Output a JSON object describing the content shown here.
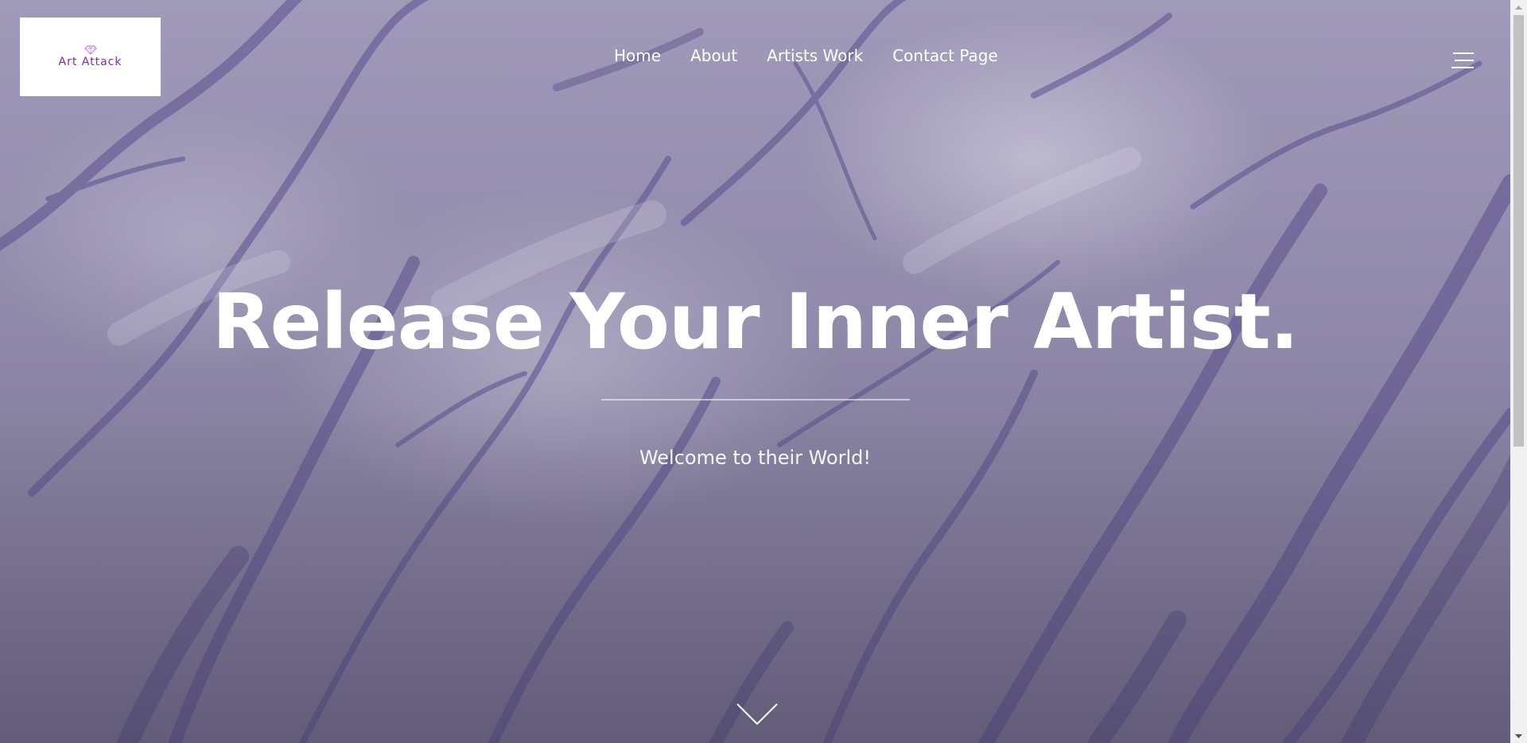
{
  "header": {
    "logo_text": "Art Attack",
    "nav": [
      {
        "label": "Home"
      },
      {
        "label": "About"
      },
      {
        "label": "Artists Work"
      },
      {
        "label": "Contact Page"
      }
    ],
    "menu_icon": "hamburger-menu-icon"
  },
  "hero": {
    "title": "Release Your Inner Artist.",
    "subtitle": "Welcome to their World!",
    "scroll_icon": "chevron-down-icon"
  },
  "colors": {
    "brand_purple": "#7a2fa0",
    "marble_base": "#9a93b4",
    "text": "#ffffff"
  }
}
